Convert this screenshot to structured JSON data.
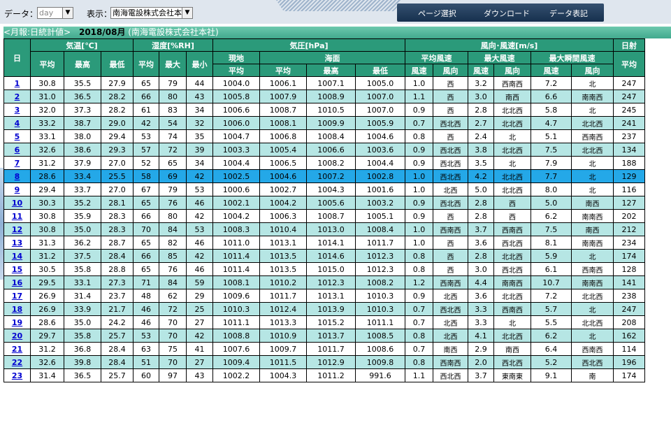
{
  "controls": {
    "data_label": "データ：",
    "data_value": "day",
    "display_label": "表示：",
    "display_value": "南海電設株式会社本社"
  },
  "menu": [
    "ページ選択",
    "ダウンロード",
    "データ表記"
  ],
  "report": {
    "title": "<月報:日統計値>",
    "year_month": "2018/08月",
    "location": "(南海電設株式会社本社)"
  },
  "headers": {
    "day": "日",
    "temp": "気温[℃]",
    "humidity": "湿度[%RH]",
    "pressure": "気圧[hPa]",
    "wind": "風向･風速[m/s]",
    "solar": "日射",
    "local": "現地",
    "sea": "海面",
    "avg_wind": "平均風速",
    "max_wind": "最大風速",
    "gust": "最大瞬間風速",
    "avg": "平均",
    "max": "最高",
    "min": "最低",
    "hmax": "最大",
    "hmin": "最小",
    "speed": "風速",
    "dir": "風向"
  },
  "highlight_day": "8",
  "rows": [
    [
      "1",
      "30.8",
      "35.5",
      "27.9",
      "65",
      "79",
      "44",
      "1004.0",
      "1006.1",
      "1007.1",
      "1005.0",
      "1.0",
      "西",
      "3.2",
      "西南西",
      "7.2",
      "北",
      "247"
    ],
    [
      "2",
      "31.0",
      "36.5",
      "28.2",
      "66",
      "80",
      "43",
      "1005.8",
      "1007.9",
      "1008.9",
      "1007.0",
      "1.1",
      "西",
      "3.0",
      "南西",
      "6.6",
      "南南西",
      "247"
    ],
    [
      "3",
      "32.0",
      "37.3",
      "28.2",
      "61",
      "83",
      "34",
      "1006.6",
      "1008.7",
      "1010.5",
      "1007.0",
      "0.9",
      "西",
      "2.8",
      "北北西",
      "5.8",
      "北",
      "245"
    ],
    [
      "4",
      "33.2",
      "38.7",
      "29.0",
      "42",
      "54",
      "32",
      "1006.0",
      "1008.1",
      "1009.9",
      "1005.9",
      "0.7",
      "西北西",
      "2.7",
      "北北西",
      "4.7",
      "北北西",
      "241"
    ],
    [
      "5",
      "33.1",
      "38.0",
      "29.4",
      "53",
      "74",
      "35",
      "1004.7",
      "1006.8",
      "1008.4",
      "1004.6",
      "0.8",
      "西",
      "2.4",
      "北",
      "5.1",
      "西南西",
      "237"
    ],
    [
      "6",
      "32.6",
      "38.6",
      "29.3",
      "57",
      "72",
      "39",
      "1003.3",
      "1005.4",
      "1006.6",
      "1003.6",
      "0.9",
      "西北西",
      "3.8",
      "北北西",
      "7.5",
      "北北西",
      "134"
    ],
    [
      "7",
      "31.2",
      "37.9",
      "27.0",
      "52",
      "65",
      "34",
      "1004.4",
      "1006.5",
      "1008.2",
      "1004.4",
      "0.9",
      "西北西",
      "3.5",
      "北",
      "7.9",
      "北",
      "188"
    ],
    [
      "8",
      "28.6",
      "33.4",
      "25.5",
      "58",
      "69",
      "42",
      "1002.5",
      "1004.6",
      "1007.2",
      "1002.8",
      "1.0",
      "西北西",
      "4.2",
      "北北西",
      "7.7",
      "北",
      "129"
    ],
    [
      "9",
      "29.4",
      "33.7",
      "27.0",
      "67",
      "79",
      "53",
      "1000.6",
      "1002.7",
      "1004.3",
      "1001.6",
      "1.0",
      "北西",
      "5.0",
      "北北西",
      "8.0",
      "北",
      "116"
    ],
    [
      "10",
      "30.3",
      "35.2",
      "28.1",
      "65",
      "76",
      "46",
      "1002.1",
      "1004.2",
      "1005.6",
      "1003.2",
      "0.9",
      "西北西",
      "2.8",
      "西",
      "5.0",
      "南西",
      "127"
    ],
    [
      "11",
      "30.8",
      "35.9",
      "28.3",
      "66",
      "80",
      "42",
      "1004.2",
      "1006.3",
      "1008.7",
      "1005.1",
      "0.9",
      "西",
      "2.8",
      "西",
      "6.2",
      "南南西",
      "202"
    ],
    [
      "12",
      "30.8",
      "35.0",
      "28.3",
      "70",
      "84",
      "53",
      "1008.3",
      "1010.4",
      "1013.0",
      "1008.4",
      "1.0",
      "西南西",
      "3.7",
      "西南西",
      "7.5",
      "南西",
      "212"
    ],
    [
      "13",
      "31.3",
      "36.2",
      "28.7",
      "65",
      "82",
      "46",
      "1011.0",
      "1013.1",
      "1014.1",
      "1011.7",
      "1.0",
      "西",
      "3.6",
      "西北西",
      "8.1",
      "南南西",
      "234"
    ],
    [
      "14",
      "31.2",
      "37.5",
      "28.4",
      "66",
      "85",
      "42",
      "1011.4",
      "1013.5",
      "1014.6",
      "1012.3",
      "0.8",
      "西",
      "2.8",
      "北北西",
      "5.9",
      "北",
      "174"
    ],
    [
      "15",
      "30.5",
      "35.8",
      "28.8",
      "65",
      "76",
      "46",
      "1011.4",
      "1013.5",
      "1015.0",
      "1012.3",
      "0.8",
      "西",
      "3.0",
      "西北西",
      "6.1",
      "西南西",
      "128"
    ],
    [
      "16",
      "29.5",
      "33.1",
      "27.3",
      "71",
      "84",
      "59",
      "1008.1",
      "1010.2",
      "1012.3",
      "1008.2",
      "1.2",
      "西南西",
      "4.4",
      "南南西",
      "10.7",
      "南南西",
      "141"
    ],
    [
      "17",
      "26.9",
      "31.4",
      "23.7",
      "48",
      "62",
      "29",
      "1009.6",
      "1011.7",
      "1013.1",
      "1010.3",
      "0.9",
      "北西",
      "3.6",
      "北北西",
      "7.2",
      "北北西",
      "238"
    ],
    [
      "18",
      "26.9",
      "33.9",
      "21.7",
      "46",
      "72",
      "25",
      "1010.3",
      "1012.4",
      "1013.9",
      "1010.3",
      "0.7",
      "西北西",
      "3.3",
      "西南西",
      "5.7",
      "北",
      "247"
    ],
    [
      "19",
      "28.6",
      "35.0",
      "24.2",
      "46",
      "70",
      "27",
      "1011.1",
      "1013.3",
      "1015.2",
      "1011.1",
      "0.7",
      "北西",
      "3.3",
      "北",
      "5.5",
      "北北西",
      "208"
    ],
    [
      "20",
      "29.7",
      "35.8",
      "25.7",
      "53",
      "70",
      "42",
      "1008.8",
      "1010.9",
      "1013.7",
      "1008.5",
      "0.8",
      "北西",
      "4.1",
      "北北西",
      "6.2",
      "北",
      "162"
    ],
    [
      "21",
      "31.2",
      "36.8",
      "28.4",
      "63",
      "75",
      "41",
      "1007.6",
      "1009.7",
      "1011.7",
      "1008.6",
      "0.7",
      "南西",
      "2.9",
      "南西",
      "6.4",
      "西南西",
      "114"
    ],
    [
      "22",
      "32.6",
      "39.8",
      "28.4",
      "51",
      "70",
      "27",
      "1009.4",
      "1011.5",
      "1012.9",
      "1009.8",
      "0.8",
      "西南西",
      "2.0",
      "西北西",
      "5.2",
      "西北西",
      "196"
    ],
    [
      "23",
      "31.4",
      "36.5",
      "25.7",
      "60",
      "97",
      "43",
      "1002.2",
      "1004.3",
      "1011.2",
      "991.6",
      "1.1",
      "西北西",
      "3.7",
      "東南東",
      "9.1",
      "南",
      "174"
    ]
  ]
}
